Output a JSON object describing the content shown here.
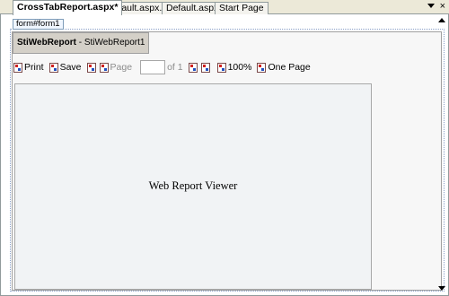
{
  "tabs": [
    {
      "label": "CrossTabReport.aspx*",
      "active": true
    },
    {
      "label": "Default.aspx.cs",
      "active": false
    },
    {
      "label": "Default.aspx",
      "active": false
    },
    {
      "label": "Start Page",
      "active": false
    }
  ],
  "tab_close_glyph": "×",
  "form_tag": "form#form1",
  "control": {
    "type": "StiWebReport",
    "separator": " - ",
    "id": "StiWebReport1"
  },
  "toolbar": {
    "print": "Print",
    "save": "Save",
    "page": "Page",
    "page_value": "",
    "of": "of 1",
    "zoom": "100%",
    "view_mode": "One Page"
  },
  "viewer": {
    "label": "Web Report Viewer"
  }
}
